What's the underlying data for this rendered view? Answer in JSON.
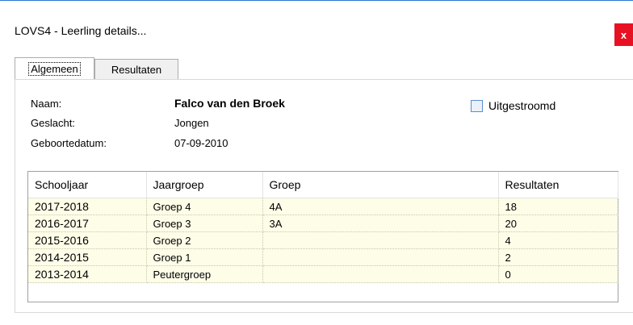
{
  "window": {
    "title": "LOVS4 - Leerling details...",
    "close_label": "x"
  },
  "tabs": [
    {
      "label": "Algemeen",
      "active": true
    },
    {
      "label": "Resultaten",
      "active": false
    }
  ],
  "student": {
    "name_label": "Naam:",
    "name_value": "Falco van den Broek",
    "gender_label": "Geslacht:",
    "gender_value": "Jongen",
    "birthdate_label": "Geboortedatum:",
    "birthdate_value": "07-09-2010",
    "outflow_label": "Uitgestroomd",
    "outflow_checked": false
  },
  "table": {
    "columns": [
      "Schooljaar",
      "Jaargroep",
      "Groep",
      "Resultaten"
    ],
    "rows": [
      [
        "2017-2018",
        "Groep 4",
        "4A",
        "18"
      ],
      [
        "2016-2017",
        "Groep 3",
        "3A",
        "20"
      ],
      [
        "2015-2016",
        "Groep 2",
        "",
        "4"
      ],
      [
        "2014-2015",
        "Groep 1",
        "",
        "2"
      ],
      [
        "2013-2014",
        "Peutergroep",
        "",
        "0"
      ]
    ]
  },
  "colors": {
    "close_bg": "#e81123",
    "row_bg": "#fdfde8",
    "checkbox_border": "#5b8fc9"
  }
}
